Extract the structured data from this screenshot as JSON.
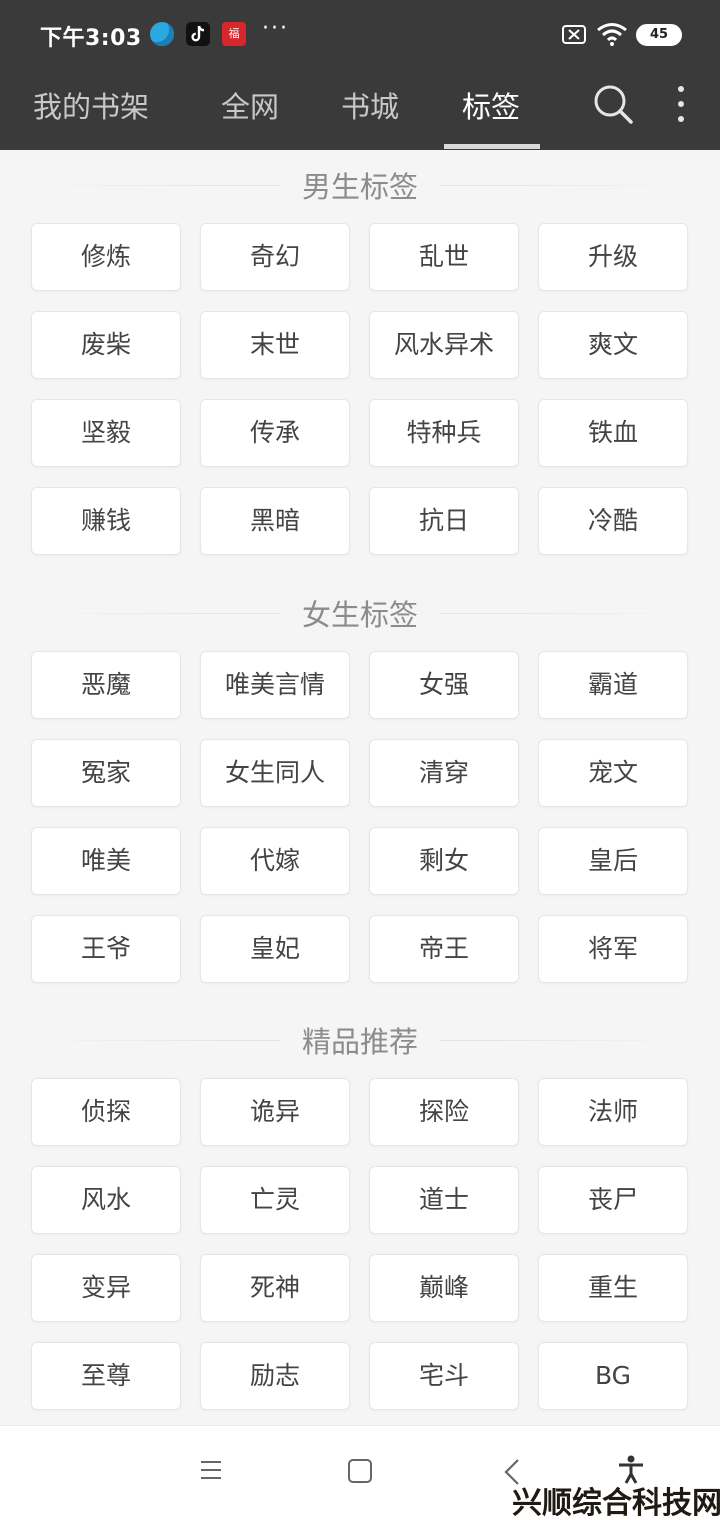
{
  "status_bar": {
    "time": "下午3:03",
    "app_badge": "福",
    "more_indicator": "···",
    "battery": "45"
  },
  "top_nav": {
    "tabs": [
      {
        "label": "我的书架"
      },
      {
        "label": "全网"
      },
      {
        "label": "书城"
      },
      {
        "label": "标签",
        "active": true
      }
    ]
  },
  "sections": [
    {
      "title": "男生标签",
      "tags": [
        "修炼",
        "奇幻",
        "乱世",
        "升级",
        "废柴",
        "末世",
        "风水异术",
        "爽文",
        "坚毅",
        "传承",
        "特种兵",
        "铁血",
        "赚钱",
        "黑暗",
        "抗日",
        "冷酷"
      ]
    },
    {
      "title": "女生标签",
      "tags": [
        "恶魔",
        "唯美言情",
        "女强",
        "霸道",
        "冤家",
        "女生同人",
        "清穿",
        "宠文",
        "唯美",
        "代嫁",
        "剩女",
        "皇后",
        "王爷",
        "皇妃",
        "帝王",
        "将军"
      ]
    },
    {
      "title": "精品推荐",
      "tags": [
        "侦探",
        "诡异",
        "探险",
        "法师",
        "风水",
        "亡灵",
        "道士",
        "丧尸",
        "变异",
        "死神",
        "巅峰",
        "重生",
        "至尊",
        "励志",
        "宅斗",
        "BG"
      ]
    }
  ],
  "watermark": "兴顺综合科技网",
  "colors": {
    "header_bg": "#3a3a3a",
    "page_bg": "#f5f5f5",
    "tag_bg": "#ffffff",
    "tag_text": "#444444",
    "section_title": "#8c8c8c"
  }
}
